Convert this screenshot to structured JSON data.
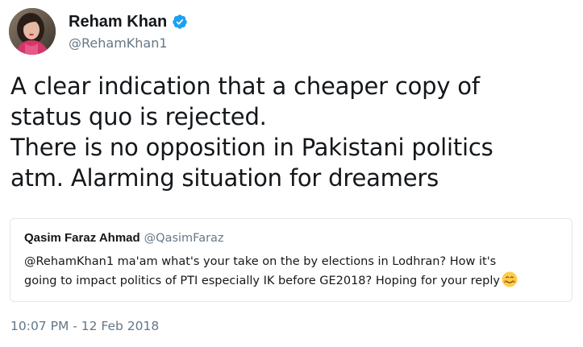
{
  "author": {
    "display_name": "Reham Khan",
    "handle": "@RehamKhan1",
    "verified": true,
    "avatar_icon": "profile-photo"
  },
  "tweet": {
    "lines": [
      "A clear indication that a cheaper copy of",
      "status quo is rejected.",
      "There is no opposition in Pakistani politics",
      "atm. Alarming situation for dreamers"
    ]
  },
  "quoted_tweet": {
    "display_name": "Qasim Faraz Ahmad",
    "handle": "@QasimFaraz",
    "lines": [
      "@RehamKhan1 ma'am what's your take on the by elections in Lodhran? How it's",
      "going to impact politics of PTI especially IK before GE2018? Hoping for your reply"
    ],
    "emoji": "smiling-face-with-hearts-emoji"
  },
  "timestamp": "10:07 PM - 12 Feb 2018",
  "colors": {
    "verified_badge": "#1da1f2",
    "secondary_text": "#657786",
    "primary_text": "#14171a",
    "quote_border": "#e1e8ed"
  }
}
